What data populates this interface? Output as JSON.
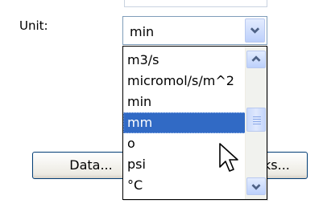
{
  "unit": {
    "label": "Unit:",
    "selected_value": "min"
  },
  "dropdown": {
    "options": [
      "m3/s",
      "micromol/s/m^2",
      "min",
      "mm",
      "o",
      "psi",
      "°C"
    ],
    "highlighted_option": "mm"
  },
  "buttons": {
    "data_label": "Data...",
    "links_label": "ks..."
  },
  "icons": {
    "combo_arrow": "chevron-down-icon",
    "scroll_up": "chevron-up-icon",
    "scroll_down": "chevron-down-icon",
    "pointer": "mouse-pointer-icon"
  },
  "colors": {
    "selection": "#316ac5",
    "xp_blue_button": "#bcd0fb",
    "chevron": "#4d6185"
  }
}
